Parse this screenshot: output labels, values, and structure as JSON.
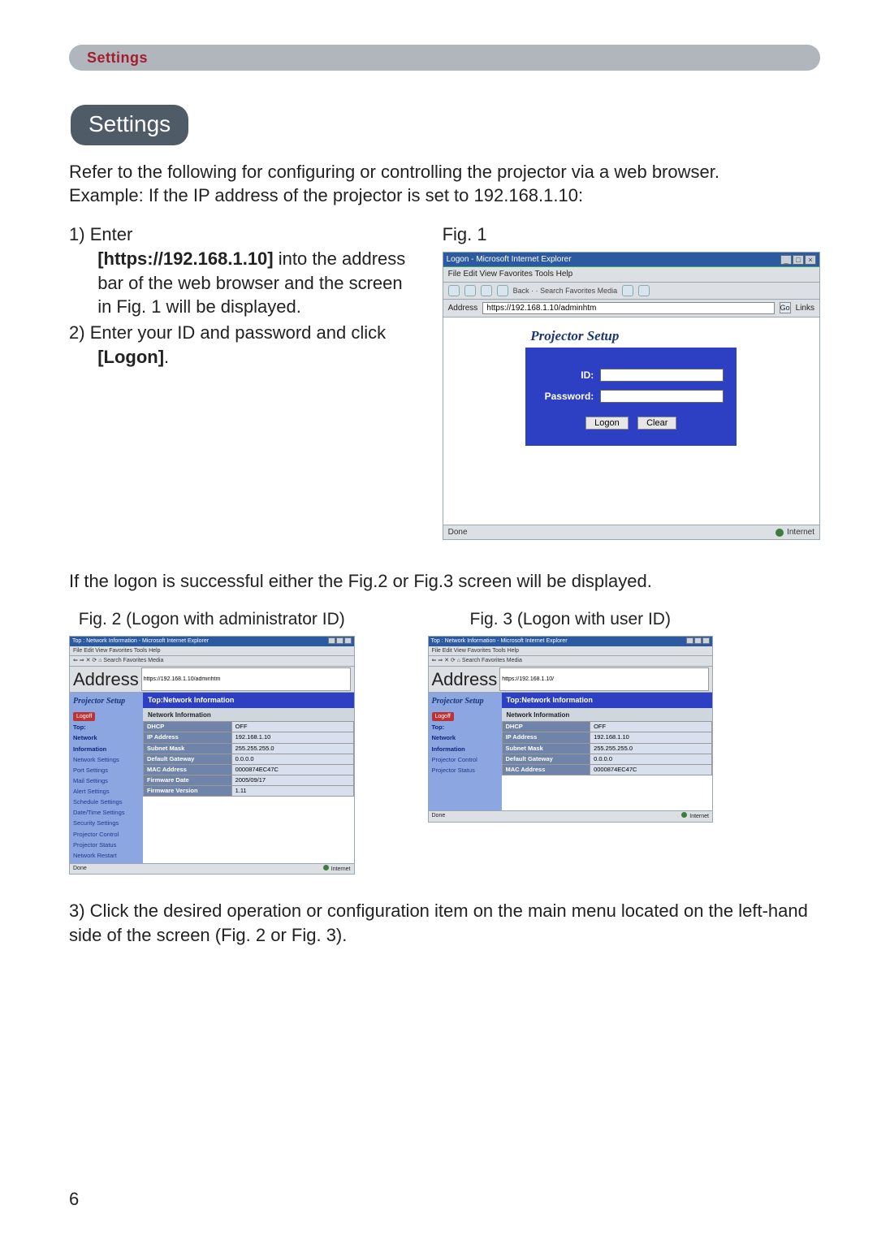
{
  "topbar": {
    "label": "Settings"
  },
  "heading": "Settings",
  "intro_lines": [
    "Refer to the following for configuring or controlling the projector via a web browser.",
    "Example: If the IP address of the projector is set to 192.168.1.10:"
  ],
  "steps": {
    "s1_a": "Enter",
    "s1_b_bold": "[https://192.168.1.10]",
    "s1_c": " into the address bar of the web browser and the screen in Fig. 1 will be displayed.",
    "s2_a": "Enter your ID and password and click ",
    "s2_b_bold": "[Logon]",
    "s2_c": "."
  },
  "fig1": {
    "label": "Fig. 1",
    "ie_title": "Logon - Microsoft Internet Explorer",
    "menubar": "File  Edit  View  Favorites  Tools  Help",
    "toolbar": "Back  ·  ·    Search  Favorites  Media",
    "addr_label": "Address",
    "addr_value": "https://192.168.1.10/adminhtm",
    "go": "Go",
    "links": "Links",
    "status_done": "Done",
    "status_zone": "Internet",
    "panel_title": "Projector Setup",
    "id_label": "ID:",
    "pw_label": "Password:",
    "id_value": "",
    "pw_value": "",
    "btn_logon": "Logon",
    "btn_clear": "Clear"
  },
  "mid_note": "If the logon is successful either the Fig.2 or Fig.3 screen will be displayed.",
  "fig2": {
    "caption": "Fig. 2 (Logon with administrator ID)",
    "ie_title": "Top : Network Information - Microsoft Internet Explorer",
    "menubar": "File  Edit  View  Favorites  Tools  Help",
    "addr_value": "https://192.168.1.10/adminhtm",
    "brand": "Projector Setup",
    "header": "Top:Network Information",
    "subheader": "Network Information",
    "logoff": "Logoff",
    "sidebar_strong": [
      "Top:",
      "Network",
      "Information"
    ],
    "sidebar_items": [
      "Network Settings",
      "Port Settings",
      "Mail Settings",
      "Alert Settings",
      "Schedule Settings",
      "Date/Time Settings",
      "Security Settings",
      "Projector Control",
      "Projector Status",
      "Network Restart"
    ],
    "rows": [
      [
        "DHCP",
        "OFF"
      ],
      [
        "IP Address",
        "192.168.1.10"
      ],
      [
        "Subnet Mask",
        "255.255.255.0"
      ],
      [
        "Default Gateway",
        "0.0.0.0"
      ],
      [
        "MAC Address",
        "0000874EC47C"
      ],
      [
        "Firmware Date",
        "2005/09/17"
      ],
      [
        "Firmware Version",
        "1.11"
      ]
    ],
    "status_done": "Done",
    "status_zone": "Internet"
  },
  "fig3": {
    "caption": "Fig. 3 (Logon with user ID)",
    "ie_title": "Top : Network Information - Microsoft Internet Explorer",
    "menubar": "File  Edit  View  Favorites  Tools  Help",
    "addr_value": "https://192.168.1.10/",
    "brand": "Projector Setup",
    "header": "Top:Network Information",
    "subheader": "Network Information",
    "logoff": "Logoff",
    "sidebar_strong": [
      "Top:",
      "Network",
      "Information"
    ],
    "sidebar_items": [
      "Projector Control",
      "Projector Status"
    ],
    "rows": [
      [
        "DHCP",
        "OFF"
      ],
      [
        "IP Address",
        "192.168.1.10"
      ],
      [
        "Subnet Mask",
        "255.255.255.0"
      ],
      [
        "Default Gateway",
        "0.0.0.0"
      ],
      [
        "MAC Address",
        "0000874EC47C"
      ]
    ],
    "status_done": "Done",
    "status_zone": "Internet"
  },
  "step3": "3) Click the desired operation or configuration item on the main menu located on the left-hand side of the screen (Fig. 2 or Fig. 3).",
  "page_number": "6"
}
